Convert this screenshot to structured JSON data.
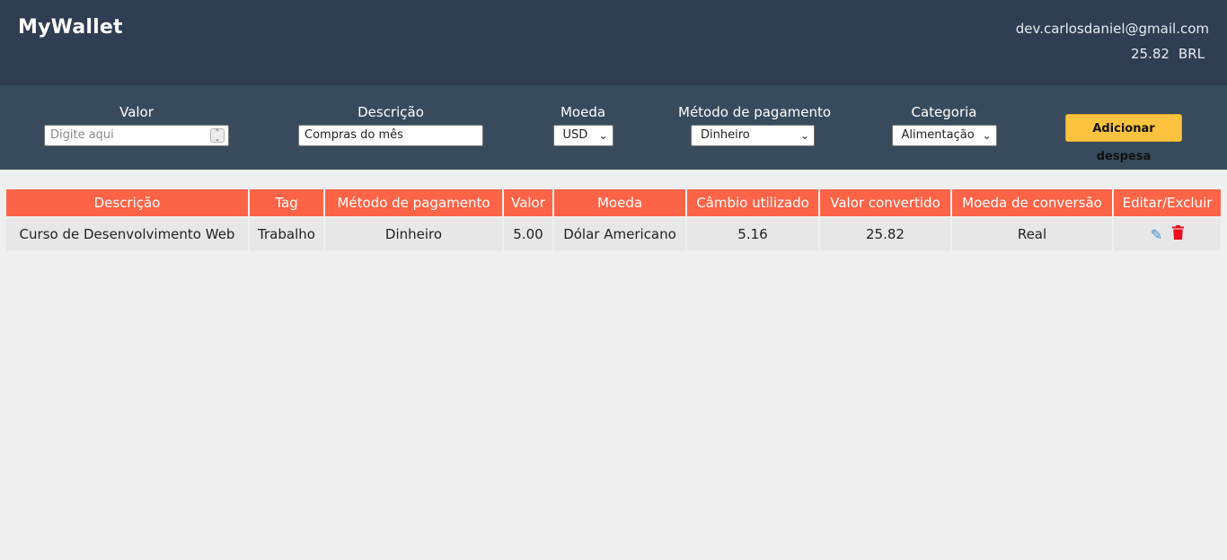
{
  "header": {
    "logo": "MyWallet",
    "email": "dev.carlosdaniel@gmail.com",
    "total": "25.82",
    "currency": "BRL"
  },
  "form": {
    "valor": {
      "label": "Valor",
      "placeholder": "Digite aqui"
    },
    "descricao": {
      "label": "Descrição",
      "value": "Compras do mês"
    },
    "moeda": {
      "label": "Moeda",
      "value": "USD"
    },
    "metodo": {
      "label": "Método de pagamento",
      "value": "Dinheiro"
    },
    "categoria": {
      "label": "Categoria",
      "value": "Alimentação"
    },
    "add_button": "Adicionar despesa"
  },
  "table": {
    "headers": [
      "Descrição",
      "Tag",
      "Método de pagamento",
      "Valor",
      "Moeda",
      "Câmbio utilizado",
      "Valor convertido",
      "Moeda de conversão",
      "Editar/Excluir"
    ],
    "rows": [
      [
        "Curso de Desenvolvimento Web",
        "Trabalho",
        "Dinheiro",
        "5.00",
        "Dólar Americano",
        "5.16",
        "25.82",
        "Real"
      ]
    ]
  },
  "icons": {
    "edit": "pencil-icon",
    "delete": "trash-icon"
  },
  "colors": {
    "header_bg": "#2f3e52",
    "form_bg": "#374b5d",
    "table_header": "#fd6447",
    "button": "#fdc33f",
    "edit": "#3f88c5",
    "delete": "#e8101d"
  }
}
